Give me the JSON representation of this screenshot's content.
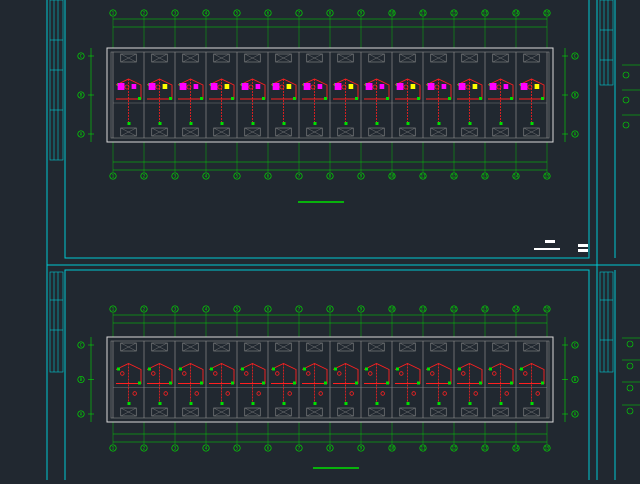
{
  "colors": {
    "background": "#212830",
    "frame": "#00c8d2",
    "outline": "#d9d9d9",
    "axis_green": "#00e000",
    "wiring_red": "#ff2020",
    "fixture_magenta": "#ff00ff",
    "fixture_yellow": "#ffff00",
    "wall_gray": "#8a8a8a"
  },
  "sheets": [
    {
      "id": "upper-plan",
      "axis_labels": [
        "1",
        "2",
        "3",
        "4",
        "5",
        "6",
        "7",
        "8",
        "9",
        "10",
        "11",
        "12",
        "13",
        "14",
        "15"
      ],
      "row_labels": [
        "C",
        "B",
        "A"
      ]
    },
    {
      "id": "lower-plan",
      "axis_labels": [
        "1",
        "2",
        "3",
        "4",
        "5",
        "6",
        "7",
        "8",
        "9",
        "10",
        "11",
        "12",
        "13",
        "14",
        "15"
      ],
      "row_labels": [
        "C",
        "B",
        "A"
      ]
    }
  ]
}
